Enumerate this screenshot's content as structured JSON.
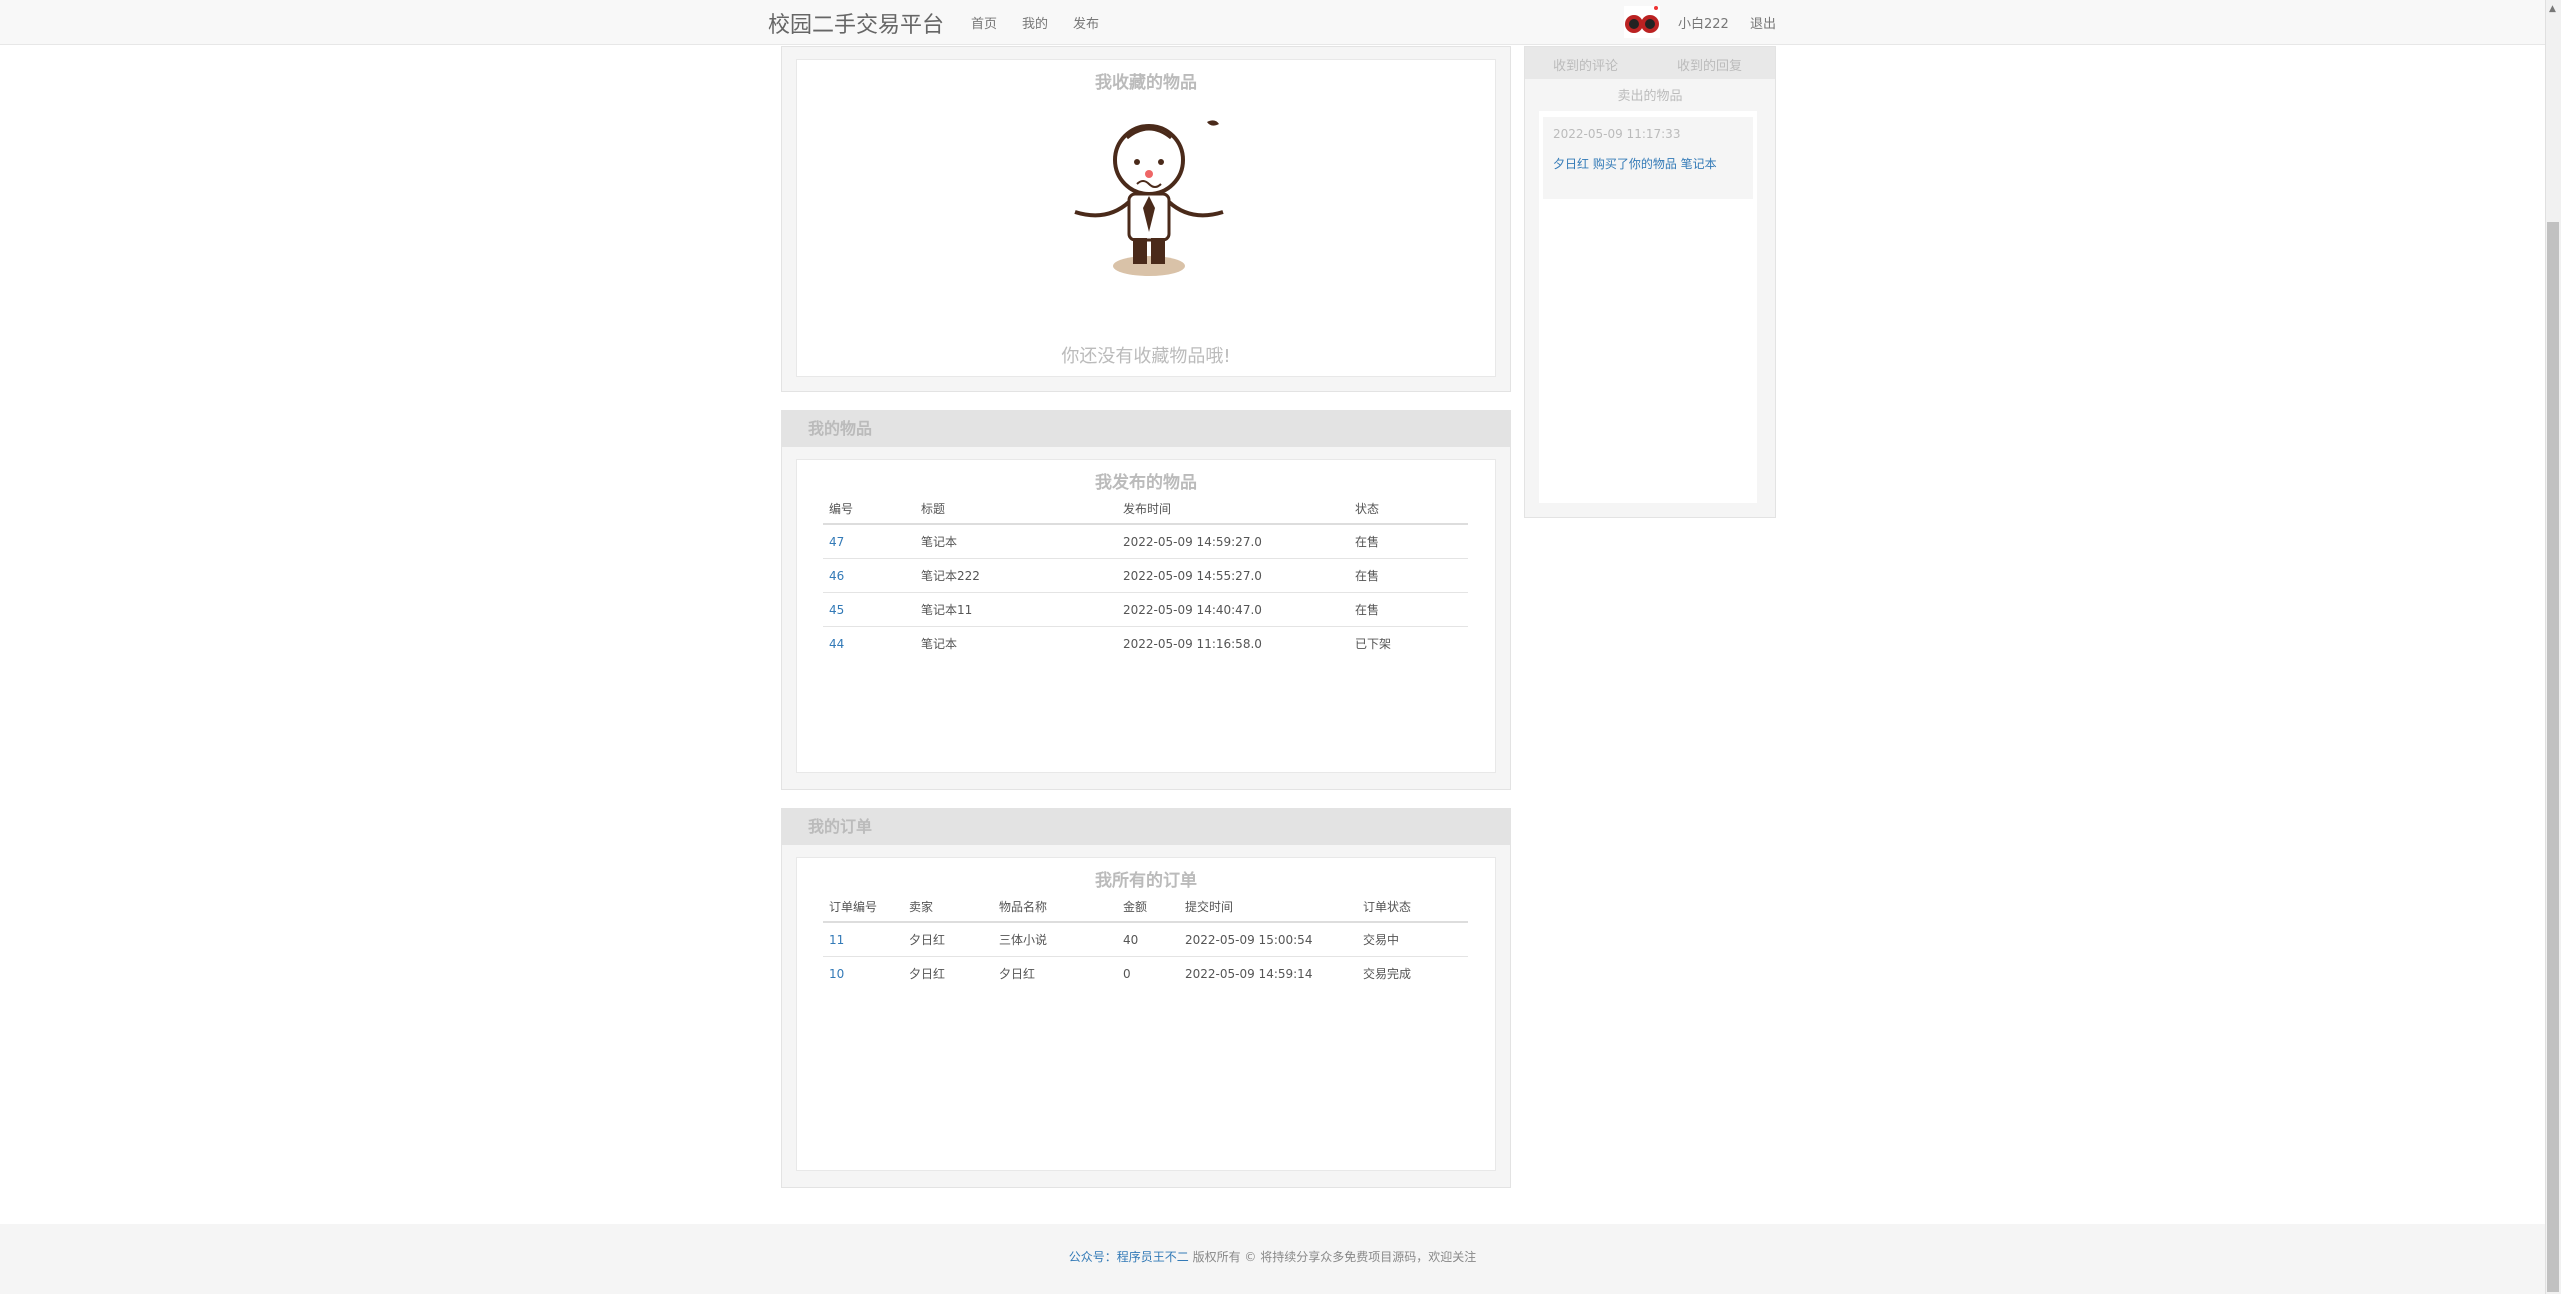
{
  "navbar": {
    "brand": "校园二手交易平台",
    "links": [
      "首页",
      "我的",
      "发布"
    ],
    "user_name": "小白222",
    "logout": "退出"
  },
  "favorites": {
    "title": "我收藏的物品",
    "empty_text": "你还没有收藏物品哦!"
  },
  "my_items": {
    "panel_title": "我的物品",
    "title": "我发布的物品",
    "columns": [
      "编号",
      "标题",
      "发布时间",
      "状态"
    ],
    "rows": [
      [
        "47",
        "笔记本",
        "2022-05-09 14:59:27.0",
        "在售"
      ],
      [
        "46",
        "笔记本222",
        "2022-05-09 14:55:27.0",
        "在售"
      ],
      [
        "45",
        "笔记本11",
        "2022-05-09 14:40:47.0",
        "在售"
      ],
      [
        "44",
        "笔记本",
        "2022-05-09 11:16:58.0",
        "已下架"
      ]
    ]
  },
  "my_orders": {
    "panel_title": "我的订单",
    "title": "我所有的订单",
    "columns": [
      "订单编号",
      "卖家",
      "物品名称",
      "金额",
      "提交时间",
      "订单状态"
    ],
    "rows": [
      [
        "11",
        "夕日红",
        "三体小说",
        "40",
        "2022-05-09 15:00:54",
        "交易中"
      ],
      [
        "10",
        "夕日红",
        "夕日红",
        "0",
        "2022-05-09 14:59:14",
        "交易完成"
      ]
    ]
  },
  "sidebar": {
    "tabs": [
      "收到的评论",
      "收到的回复"
    ],
    "subtitle": "卖出的物品",
    "message_time": "2022-05-09 11:17:33",
    "message_text": "夕日红 购买了你的物品 笔记本"
  },
  "footer": {
    "link_text": "公众号：程序员王不二",
    "rest_text": " 版权所有 © 将持续分享众多免费项目源码，欢迎关注"
  },
  "colors": {
    "link": "#337ab7",
    "muted": "#bbbbbb",
    "accent_corner": "#1e90ff"
  }
}
